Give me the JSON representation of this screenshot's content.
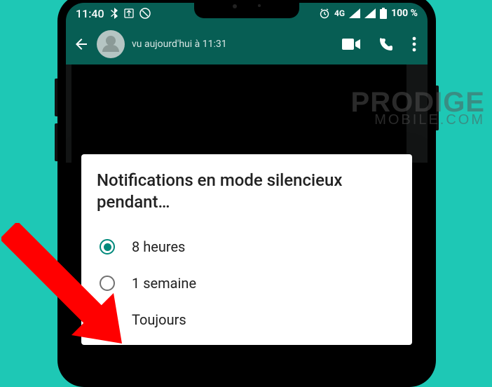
{
  "status": {
    "time": "11:40",
    "network_label": "4G",
    "battery": "100 %"
  },
  "header": {
    "last_seen": "vu aujourd'hui à 11:31"
  },
  "chat": {
    "dark_text": ""
  },
  "dialog": {
    "title": "Notifications en mode silencieux pendant…",
    "options": [
      {
        "label": "8 heures",
        "selected": true
      },
      {
        "label": "1 semaine",
        "selected": false
      },
      {
        "label": "Toujours",
        "selected": false
      }
    ]
  },
  "watermark": {
    "line1": "PRODIGE",
    "line2": "MOBILE.COM"
  }
}
